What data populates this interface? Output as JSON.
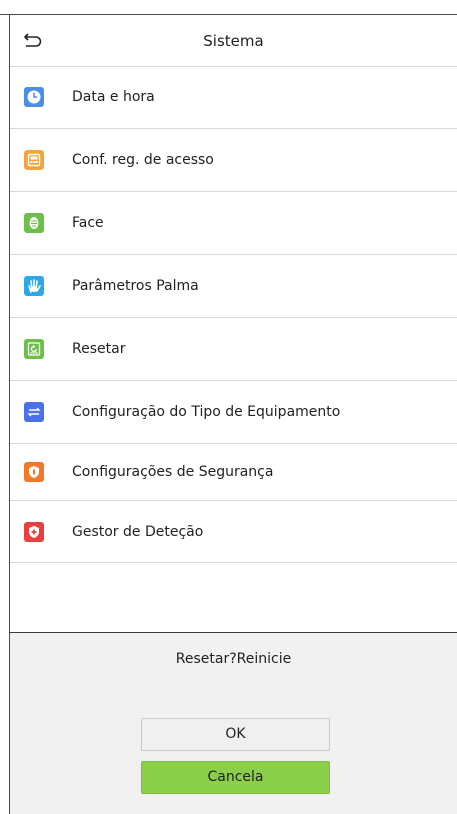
{
  "header": {
    "title": "Sistema",
    "back_icon": "back-arrow-icon"
  },
  "menu": {
    "items": [
      {
        "label": "Data e hora",
        "icon": "clock-icon",
        "color": "#4a90e2"
      },
      {
        "label": "Conf. reg. de acesso",
        "icon": "access-log-icon",
        "color": "#f5a43c"
      },
      {
        "label": "Face",
        "icon": "face-icon",
        "color": "#6cc04a"
      },
      {
        "label": "Parâmetros Palma",
        "icon": "palm-icon",
        "color": "#2ea6e8"
      },
      {
        "label": "Resetar",
        "icon": "reset-icon",
        "color": "#6cc04a"
      },
      {
        "label": "Configuração do Tipo de Equipamento",
        "icon": "device-type-icon",
        "color": "#4a72e8"
      },
      {
        "label": "Configurações de Segurança",
        "icon": "security-shield-icon",
        "color": "#f07a2a"
      },
      {
        "label": "Gestor de Deteção",
        "icon": "detection-shield-icon",
        "color": "#e84040"
      }
    ]
  },
  "dialog": {
    "message": "Resetar?Reinicie",
    "ok_label": "OK",
    "cancel_label": "Cancela",
    "cancel_color": "#8ccf4a"
  }
}
